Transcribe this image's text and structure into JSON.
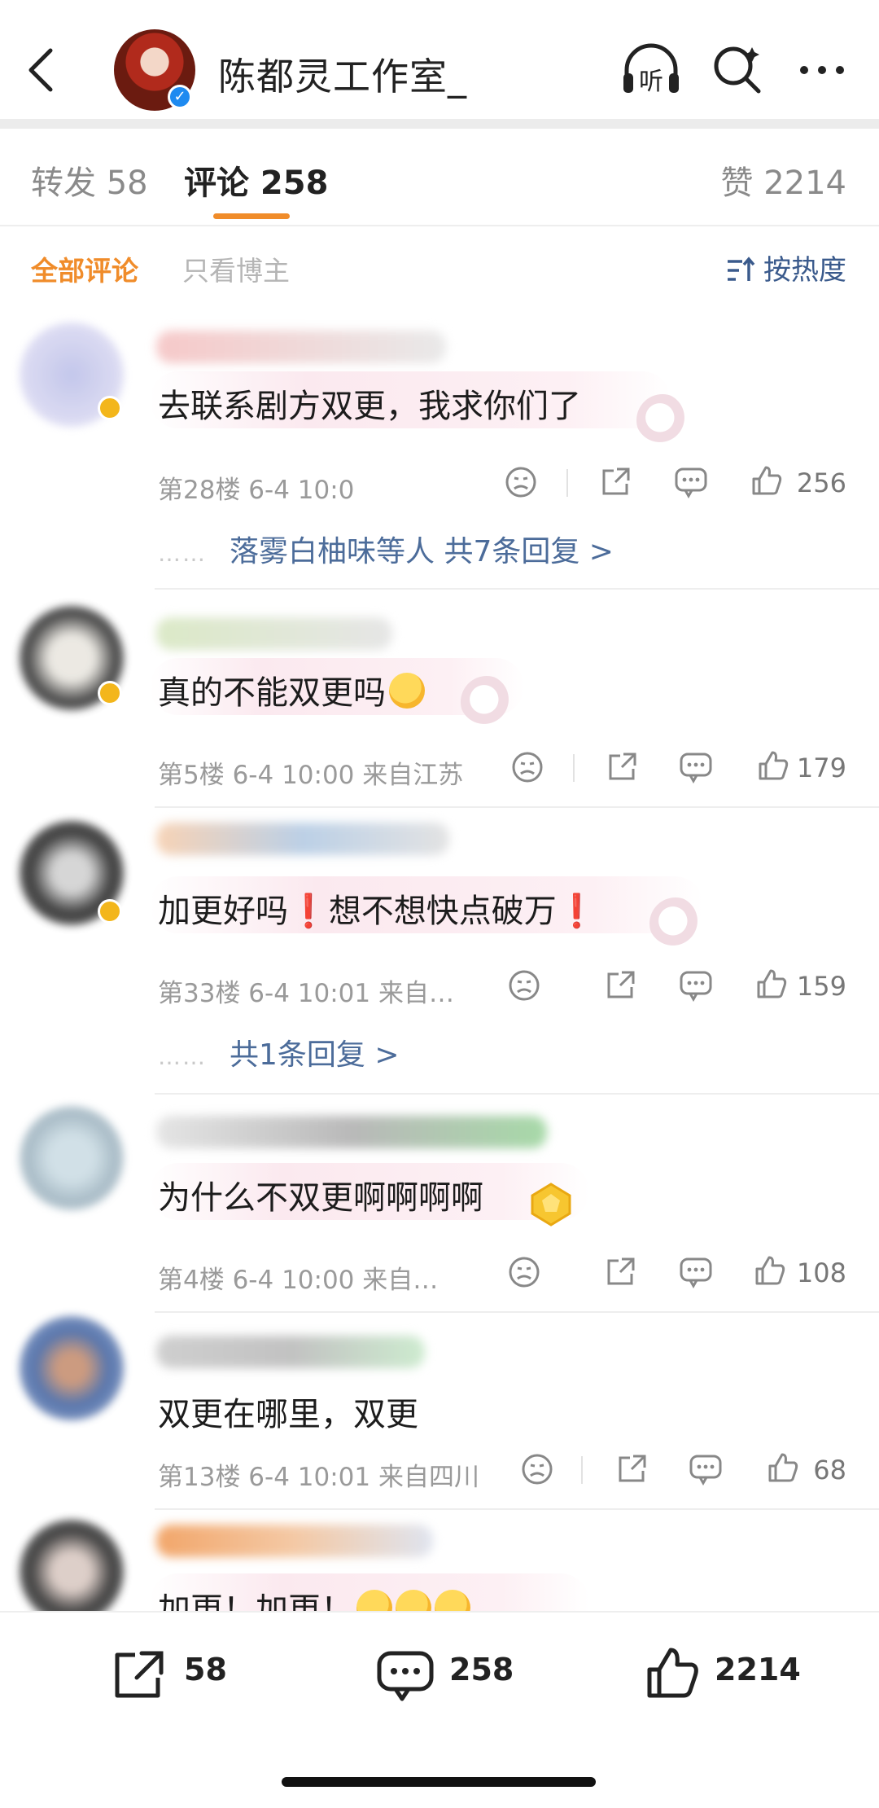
{
  "header": {
    "title": "陈都灵工作室_",
    "listen_label": "听",
    "verified_mark": "✓"
  },
  "tabs": [
    {
      "label": "转发 58"
    },
    {
      "label": "评论 258"
    },
    {
      "label": "赞 2214"
    }
  ],
  "filter": {
    "all_label": "全部评论",
    "author_label": "只看博主",
    "sort_label": "按热度"
  },
  "comments": [
    {
      "text": "去联系剧方双更，我求你们了",
      "meta": "第28楼 6-4 10:0",
      "likes": "256",
      "reply_link": "落雾白柚味等人  共7条回复 >"
    },
    {
      "text": "真的不能双更吗",
      "meta": "第5楼  6-4 10:00  来自江苏",
      "likes": "179"
    },
    {
      "text_parts": [
        "加更好吗",
        "❗",
        "想不想快点破万",
        "❗"
      ],
      "meta": "第33楼  6-4 10:01  来自…",
      "likes": "159",
      "reply_link": "共1条回复 >"
    },
    {
      "text": "为什么不双更啊啊啊啊",
      "meta": "第4楼  6-4 10:00  来自…",
      "likes": "108"
    },
    {
      "text": "双更在哪里，双更",
      "meta": "第13楼  6-4 10:01  来自四川",
      "likes": "68"
    },
    {
      "text": "加更！加更！"
    }
  ],
  "reply_dots": "……",
  "bottom_bar": {
    "repost_count": "58",
    "comment_count": "258",
    "like_count": "2214"
  },
  "colors": {
    "accent_orange": "#f08c2a",
    "link_blue": "#4c6c9a",
    "verified_gold": "#f3b61b"
  }
}
